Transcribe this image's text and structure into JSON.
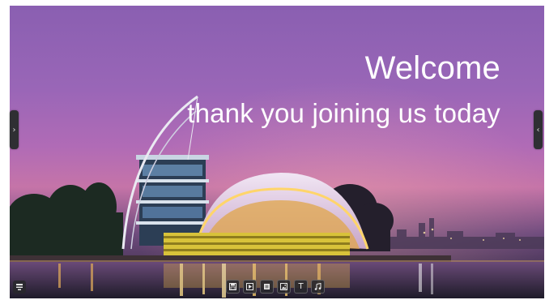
{
  "slide": {
    "title": "Welcome",
    "subtitle": "thank you joining us today"
  },
  "navigation": {
    "prev_glyph": "›",
    "next_glyph": "‹"
  },
  "corner_button": {
    "icon": "menu-icon"
  },
  "toolbar": {
    "items": [
      {
        "icon": "save-icon"
      },
      {
        "icon": "play-icon"
      },
      {
        "icon": "stop-icon"
      },
      {
        "icon": "image-icon"
      },
      {
        "icon": "text-icon",
        "glyph": "T"
      },
      {
        "icon": "music-icon"
      }
    ]
  },
  "colors": {
    "sky_top": "#8a5fb1",
    "sky_horizon": "#c574a8",
    "water": "#2b2538",
    "handle": "#2f2f33",
    "text": "#ffffff"
  }
}
